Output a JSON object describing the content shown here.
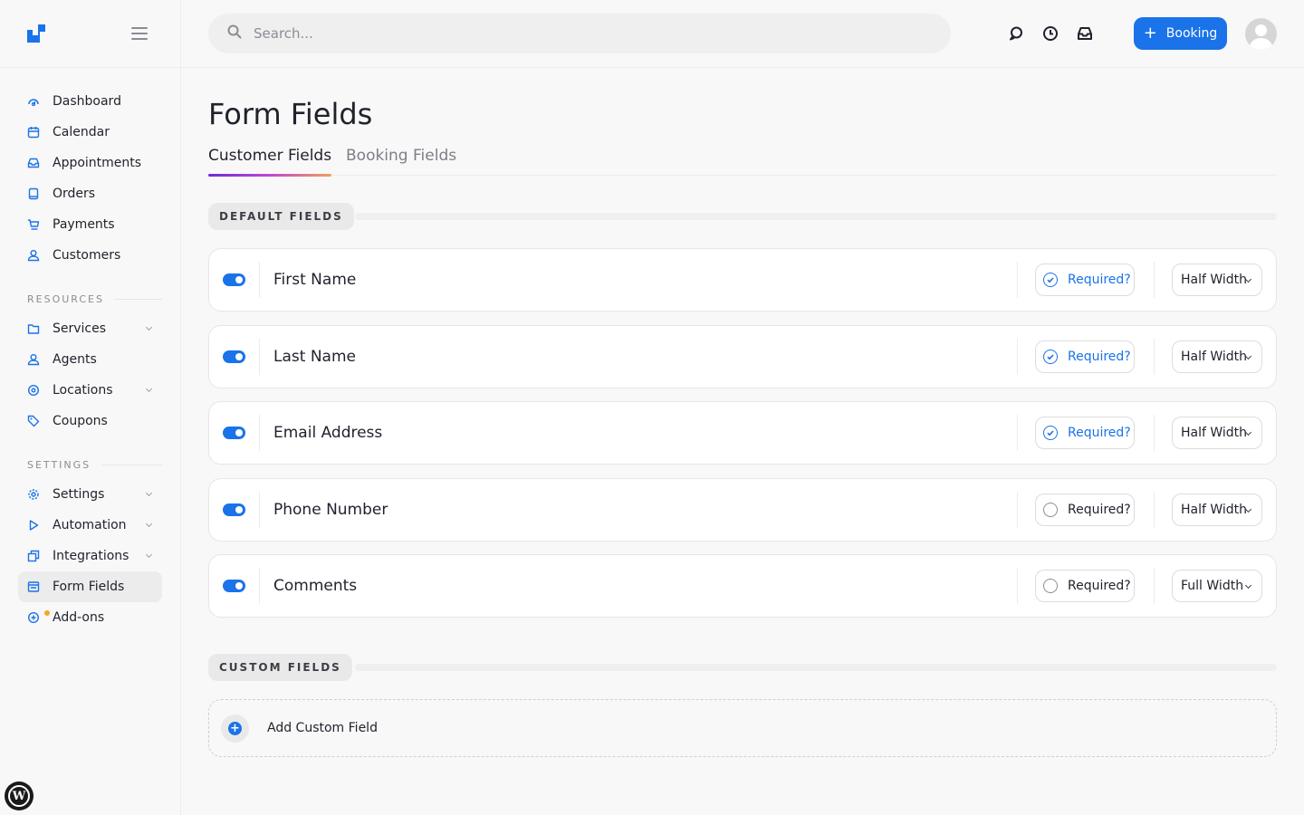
{
  "app": {
    "accent_color": "#1a73e8"
  },
  "sidebar": {
    "menu_icon": "hamburger-icon",
    "items": [
      {
        "label": "Dashboard",
        "icon": "dashboard-icon"
      },
      {
        "label": "Calendar",
        "icon": "calendar-icon"
      },
      {
        "label": "Appointments",
        "icon": "inbox-icon"
      },
      {
        "label": "Orders",
        "icon": "tablet-icon"
      },
      {
        "label": "Payments",
        "icon": "cart-icon"
      },
      {
        "label": "Customers",
        "icon": "user-icon"
      }
    ],
    "resources_label": "RESOURCES",
    "resources": [
      {
        "label": "Services",
        "icon": "folder-icon"
      },
      {
        "label": "Agents",
        "icon": "user-icon"
      },
      {
        "label": "Locations",
        "icon": "location-pin-icon"
      },
      {
        "label": "Coupons",
        "icon": "tag-icon"
      }
    ],
    "settings_label": "SETTINGS",
    "settings": [
      {
        "label": "Settings",
        "icon": "gear-icon"
      },
      {
        "label": "Automation",
        "icon": "play-icon"
      },
      {
        "label": "Integrations",
        "icon": "windows-icon"
      },
      {
        "label": "Form Fields",
        "icon": "form-icon",
        "active": true
      },
      {
        "label": "Add-ons",
        "icon": "plus-circle-icon",
        "has_badge": true
      }
    ]
  },
  "header": {
    "search_placeholder": "Search...",
    "booking_label": "Booking",
    "icons": [
      "chat-icon",
      "clock-icon",
      "inbox-icon"
    ]
  },
  "main": {
    "title": "Form Fields",
    "tabs": [
      {
        "label": "Customer Fields",
        "active": true
      },
      {
        "label": "Booking Fields",
        "active": false
      }
    ],
    "default_section_label": "DEFAULT FIELDS",
    "fields": [
      {
        "label": "First Name",
        "enabled": true,
        "required": true,
        "required_label": "Required?",
        "width": "Half Width"
      },
      {
        "label": "Last Name",
        "enabled": true,
        "required": true,
        "required_label": "Required?",
        "width": "Half Width"
      },
      {
        "label": "Email Address",
        "enabled": true,
        "required": true,
        "required_label": "Required?",
        "width": "Half Width"
      },
      {
        "label": "Phone Number",
        "enabled": true,
        "required": false,
        "required_label": "Required?",
        "width": "Half Width"
      },
      {
        "label": "Comments",
        "enabled": true,
        "required": false,
        "required_label": "Required?",
        "width": "Full Width"
      }
    ],
    "custom_section_label": "CUSTOM FIELDS",
    "add_custom_label": "Add Custom Field"
  }
}
